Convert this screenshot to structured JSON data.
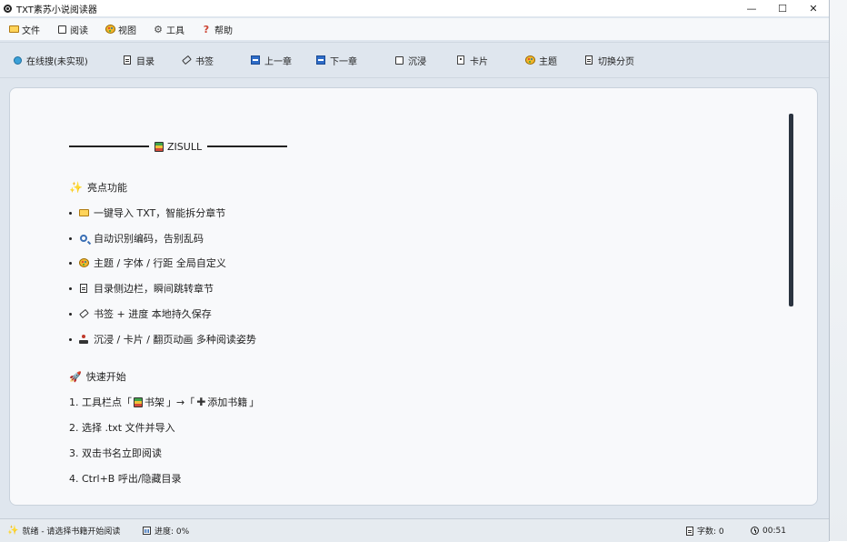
{
  "window": {
    "title": "TXT素苏小说阅读器"
  },
  "menu": {
    "items": [
      {
        "icon": "folder-icon",
        "label": "文件"
      },
      {
        "icon": "square-icon",
        "label": "阅读"
      },
      {
        "icon": "palette-icon",
        "label": "视图"
      },
      {
        "icon": "gear-icon",
        "label": "工具"
      },
      {
        "icon": "question-icon",
        "label": "帮助"
      }
    ]
  },
  "toolbar": {
    "search": "在线搜(未实现)",
    "toc": "目录",
    "bookmark": "书签",
    "prev_chapter": "上一章",
    "next_chapter": "下一章",
    "immersive": "沉浸",
    "card": "卡片",
    "theme": "主题",
    "switch_paging": "切换分页"
  },
  "content": {
    "heading": "ZISULL",
    "features_title": "亮点功能",
    "features": [
      {
        "icon": "folder-icon",
        "text": "一键导入 TXT，智能拆分章节"
      },
      {
        "icon": "magnifier-icon",
        "text": "自动识别编码，告别乱码"
      },
      {
        "icon": "palette-icon",
        "text": "主题 / 字体 / 行距 全局自定义"
      },
      {
        "icon": "clipboard-icon",
        "text": "目录侧边栏，瞬间跳转章节"
      },
      {
        "icon": "tag-icon",
        "text": "书签 + 进度 本地持久保存"
      },
      {
        "icon": "joystick-icon",
        "text": "沉浸 / 卡片 / 翻页动画 多种阅读姿势"
      }
    ],
    "quickstart_title": "快速开始",
    "steps": {
      "s1_prefix": "1. 工具栏点「",
      "s1_shelf": "书架",
      "s1_mid": "」→「",
      "s1_add": "添加书籍",
      "s1_end": "」",
      "s2": "2. 选择 .txt 文件并导入",
      "s3": "3. 双击书名立即阅读",
      "s4": "4. Ctrl+B 呼出/隐藏目录"
    }
  },
  "status": {
    "ready": "就绪 - 请选择书籍开始阅读",
    "progress": "进度: 0%",
    "word_count": "字数: 0",
    "time": "00:51"
  }
}
